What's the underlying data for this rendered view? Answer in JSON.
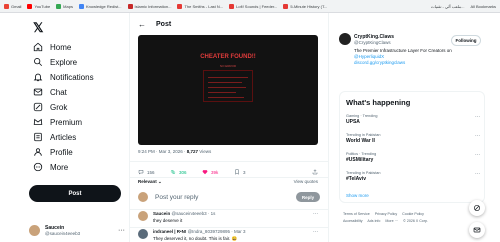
{
  "bookmarks": [
    "Gmail",
    "YouTube",
    "Maps",
    "Knowledge Redist...",
    "Islamic Information...",
    "The Smiths - Last N...",
    "Lofi! Sounds | Feeder...",
    "5-Minute History (T..."
  ],
  "bookmarks_right": [
    "ملعب آلي - تقنيات...",
    "All Bookmarks"
  ],
  "nav": {
    "logo": "𝕏",
    "items": [
      {
        "label": "Home",
        "icon": "home-icon"
      },
      {
        "label": "Explore",
        "icon": "search-icon"
      },
      {
        "label": "Notifications",
        "icon": "bell-icon"
      },
      {
        "label": "Chat",
        "icon": "chat-icon"
      },
      {
        "label": "Grok",
        "icon": "grok-icon"
      },
      {
        "label": "Premium",
        "icon": "premium-icon"
      },
      {
        "label": "Articles",
        "icon": "articles-icon"
      },
      {
        "label": "Profile",
        "icon": "profile-icon"
      },
      {
        "label": "More",
        "icon": "more-icon"
      }
    ],
    "post_button": "Post",
    "account": {
      "name": "Saucein",
      "handle": "@saucein4eeeb3"
    }
  },
  "main": {
    "title": "Post",
    "media": {
      "headline": "CHEATER FOUND!!",
      "subline": "NO ERROR"
    },
    "meta": {
      "time": "9:24 PM · Mar 3, 2026 · ",
      "views_count": "8,727",
      "views_label": " Views"
    },
    "stats": {
      "replies": "156",
      "reposts": "306",
      "likes": "39k",
      "bookmarks": "3"
    },
    "sort_label": "Relevant",
    "view_quotes": "View quotes",
    "reply_placeholder": "Post your reply",
    "reply_button": "Reply",
    "replies": [
      {
        "name": "Saucein",
        "handle": "@saucein4eeeb3 · 1s",
        "text": "they deserve it"
      },
      {
        "name": "indraneel | R•N!",
        "handle": "@Indra_8039729895 · Mar 3",
        "text": "They deserved it, no doubt. This is fair. 😄",
        "stats": {
          "replies": "",
          "reposts": "",
          "likes": "3",
          "views": "169"
        }
      }
    ]
  },
  "side": {
    "promo": {
      "name": "CryptKing.Claws",
      "handle": "@CryptKingClaws",
      "follow": "Following",
      "bio": "The Premier Infrastructure Layer For Creators on ",
      "bio_link1": "@HyperliquidX",
      "bio_link2": "discord.gg/cryptkingclaws"
    },
    "whats_happening": "What's happening",
    "trends": [
      {
        "category": "Gaming · Trending",
        "name": "UPSA"
      },
      {
        "category": "Trending in Pakistan",
        "name": "World War II"
      },
      {
        "category": "Politics · Trending",
        "name": "#USMilitary"
      },
      {
        "category": "Trending in Pakistan",
        "name": "#TelAviv"
      }
    ],
    "show_more": "Show more",
    "footer": [
      "Terms of Service",
      "Privacy Policy",
      "Cookie Policy",
      "Accessibility",
      "Ads info",
      "More ···",
      "© 2026 X Corp."
    ]
  },
  "colors": {
    "accent": "#1d9bf0",
    "like": "#f91880",
    "repost": "#00ba7c",
    "cheater": "#e03b3b"
  }
}
